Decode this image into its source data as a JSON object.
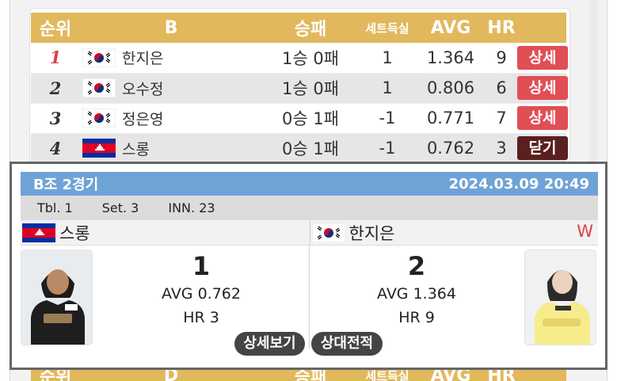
{
  "group_table": {
    "headers": {
      "rank": "순위",
      "player": "B",
      "winloss": "승패",
      "sets": "세트득실",
      "avg": "AVG",
      "hr": "HR"
    },
    "rows": [
      {
        "rank": "1",
        "flag": "korea-flag",
        "name": "한지은",
        "winloss": "1승 0패",
        "sets": "1",
        "avg": "1.364",
        "hr": "9",
        "button": "상세"
      },
      {
        "rank": "2",
        "flag": "korea-flag",
        "name": "오수정",
        "winloss": "1승 0패",
        "sets": "1",
        "avg": "0.806",
        "hr": "6",
        "button": "상세"
      },
      {
        "rank": "3",
        "flag": "korea-flag",
        "name": "정은영",
        "winloss": "0승 1패",
        "sets": "-1",
        "avg": "0.771",
        "hr": "7",
        "button": "상세"
      },
      {
        "rank": "4",
        "flag": "cambodia-flag",
        "name": "스롱",
        "winloss": "0승 1패",
        "sets": "-1",
        "avg": "0.762",
        "hr": "3",
        "button": "닫기"
      }
    ]
  },
  "group_table_2": {
    "headers": {
      "rank": "순위",
      "player": "D",
      "winloss": "승패",
      "sets": "세트득실",
      "avg": "AVG",
      "hr": "HR"
    }
  },
  "match": {
    "title": "B조 2경기",
    "datetime": "2024.03.09 20:49",
    "table": "Tbl. 1",
    "set": "Set. 3",
    "inning": "INN. 23",
    "left": {
      "name": "스롱",
      "flag": "cambodia-flag",
      "score": "1",
      "avg": "AVG 0.762",
      "hr": "HR 3"
    },
    "right": {
      "name": "한지은",
      "flag": "korea-flag",
      "score": "2",
      "avg": "AVG 1.364",
      "hr": "HR 9",
      "result": "W"
    },
    "buttons": {
      "detail": "상세보기",
      "head_to_head": "상대전적"
    }
  },
  "colors": {
    "header_gold": "#e2b85c",
    "detail_red": "#df4f55",
    "close_dark": "#5a1f1f",
    "match_blue": "#6fa3d6",
    "winner_red": "#d9414a"
  }
}
